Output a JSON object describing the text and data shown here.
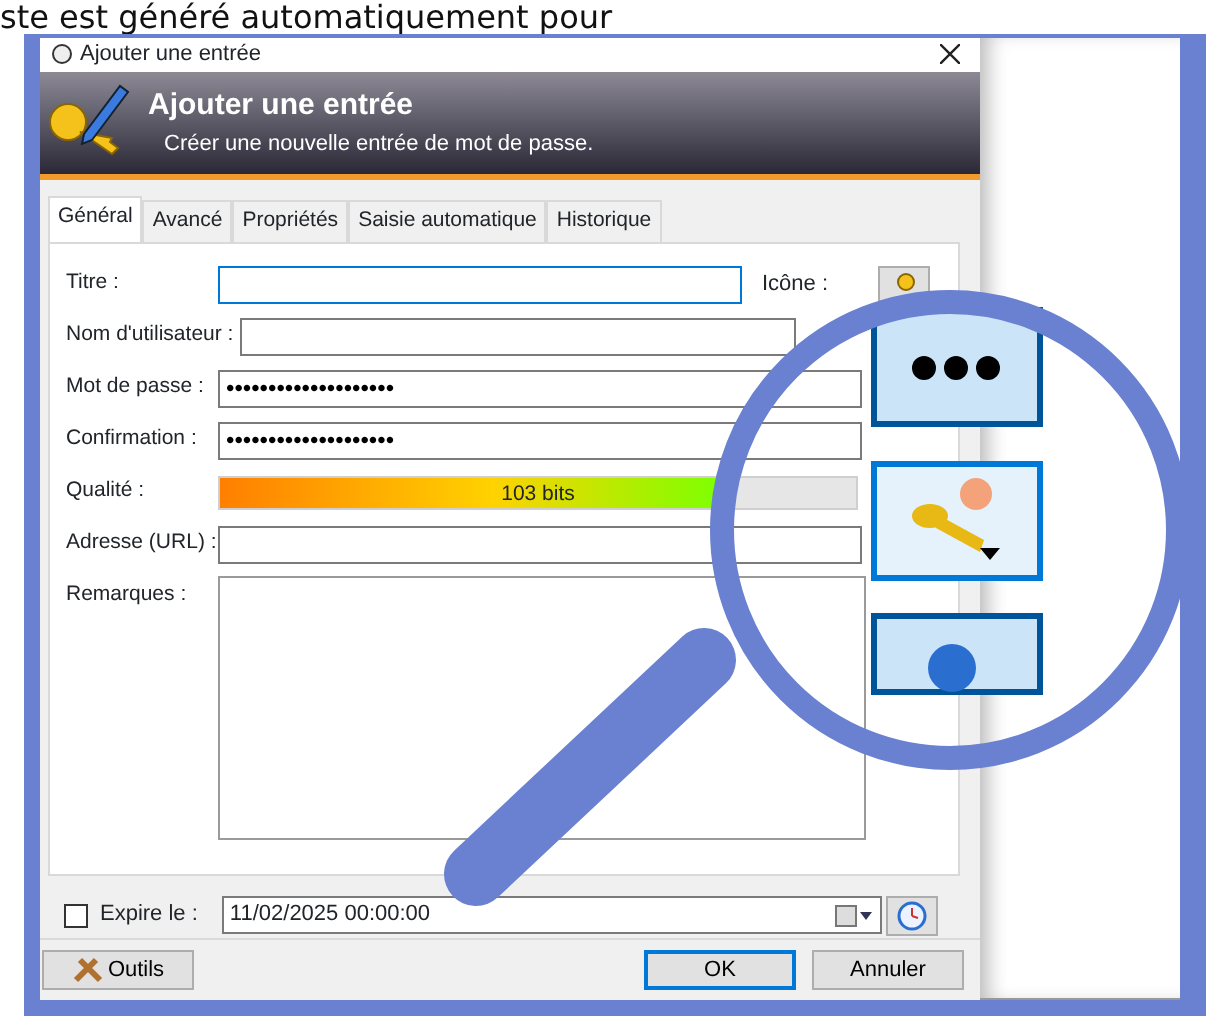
{
  "background_text": "ste est généré automatiquement pour",
  "window": {
    "title": "Ajouter une entrée"
  },
  "banner": {
    "title": "Ajouter une entrée",
    "subtitle": "Créer une nouvelle entrée de mot de passe."
  },
  "tabs": [
    {
      "label": "Général",
      "selected": true
    },
    {
      "label": "Avancé",
      "selected": false
    },
    {
      "label": "Propriétés",
      "selected": false
    },
    {
      "label": "Saisie automatique",
      "selected": false
    },
    {
      "label": "Historique",
      "selected": false
    }
  ],
  "fields": [
    {
      "kind": "title",
      "label": "Titre :",
      "focused": true,
      "icon_label": "Icône :"
    },
    {
      "kind": "text",
      "label": "Nom d'utilisateur :",
      "focused": false
    },
    {
      "kind": "password",
      "label": "Mot de passe :",
      "value": "••••••••••••••••••••",
      "focused": false
    },
    {
      "kind": "password",
      "label": "Confirmation :",
      "value": "••••••••••••••••••••",
      "focused": false
    },
    {
      "kind": "quality",
      "label": "Qualité :",
      "level": 0.78,
      "reading": "103 bits"
    },
    {
      "kind": "text",
      "label": "Adresse (URL) :",
      "focused": false
    },
    {
      "kind": "notes",
      "label": "Remarques :"
    }
  ],
  "expiry": {
    "label": "Expire le :",
    "checked": false,
    "value": "11/02/2025 00:00:00"
  },
  "buttons": [
    {
      "label": "Outils",
      "kind": "tools",
      "default": false
    },
    {
      "label": "OK",
      "kind": "plain",
      "default": true
    },
    {
      "label": "Annuler",
      "kind": "plain",
      "default": false
    }
  ]
}
